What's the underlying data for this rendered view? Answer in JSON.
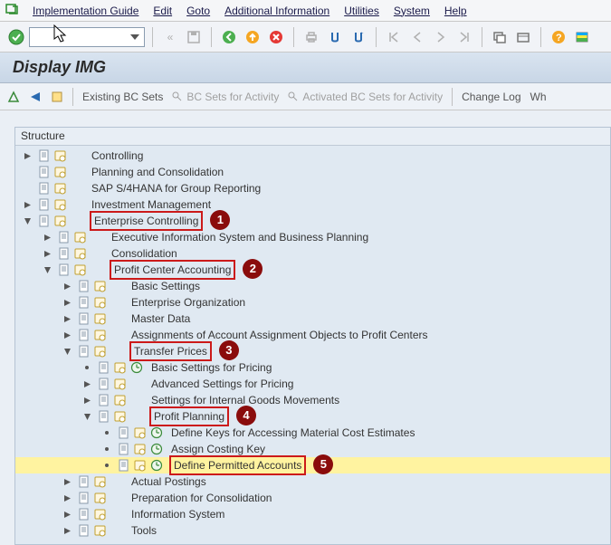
{
  "menu": {
    "items": [
      "Implementation Guide",
      "Edit",
      "Goto",
      "Additional Information",
      "Utilities",
      "System",
      "Help"
    ]
  },
  "title": "Display IMG",
  "subtoolbar": {
    "existing_bc_sets": "Existing BC Sets",
    "bc_sets_for_activity": "BC Sets for Activity",
    "activated_bc_sets": "Activated BC Sets for Activity",
    "change_log": "Change Log",
    "where_else": "Wh"
  },
  "tree": {
    "header": "Structure",
    "nodes": [
      {
        "depth": 0,
        "exp": "closed",
        "icons": [
          "doc",
          "exec"
        ],
        "label": "Controlling"
      },
      {
        "depth": 0,
        "exp": "none",
        "icons": [
          "doc",
          "exec"
        ],
        "label": "Planning and Consolidation"
      },
      {
        "depth": 0,
        "exp": "none",
        "icons": [
          "doc",
          "exec"
        ],
        "label": "SAP S/4HANA for Group Reporting"
      },
      {
        "depth": 0,
        "exp": "closed",
        "icons": [
          "doc",
          "exec"
        ],
        "label": "Investment Management"
      },
      {
        "depth": 0,
        "exp": "open",
        "icons": [
          "doc",
          "exec"
        ],
        "label": "Enterprise Controlling",
        "boxed": true,
        "badge": "1"
      },
      {
        "depth": 1,
        "exp": "closed",
        "icons": [
          "doc",
          "exec"
        ],
        "label": "Executive Information System and Business Planning"
      },
      {
        "depth": 1,
        "exp": "closed",
        "icons": [
          "doc",
          "exec"
        ],
        "label": "Consolidation"
      },
      {
        "depth": 1,
        "exp": "open",
        "icons": [
          "doc",
          "exec"
        ],
        "label": "Profit Center Accounting",
        "boxed": true,
        "badge": "2"
      },
      {
        "depth": 2,
        "exp": "closed",
        "icons": [
          "doc",
          "exec"
        ],
        "label": "Basic Settings"
      },
      {
        "depth": 2,
        "exp": "closed",
        "icons": [
          "doc",
          "exec"
        ],
        "label": "Enterprise Organization"
      },
      {
        "depth": 2,
        "exp": "closed",
        "icons": [
          "doc",
          "exec"
        ],
        "label": "Master Data"
      },
      {
        "depth": 2,
        "exp": "closed",
        "icons": [
          "doc",
          "exec"
        ],
        "label": "Assignments of Account Assignment Objects to Profit Centers"
      },
      {
        "depth": 2,
        "exp": "open",
        "icons": [
          "doc",
          "exec"
        ],
        "label": "Transfer Prices",
        "boxed": true,
        "badge": "3"
      },
      {
        "depth": 3,
        "exp": "leaf",
        "icons": [
          "doc",
          "exec",
          "clock"
        ],
        "label": "Basic Settings for Pricing"
      },
      {
        "depth": 3,
        "exp": "closed",
        "icons": [
          "doc",
          "exec"
        ],
        "label": "Advanced Settings for Pricing"
      },
      {
        "depth": 3,
        "exp": "closed",
        "icons": [
          "doc",
          "exec"
        ],
        "label": "Settings for Internal Goods Movements"
      },
      {
        "depth": 3,
        "exp": "open",
        "icons": [
          "doc",
          "exec"
        ],
        "label": "Profit Planning",
        "boxed": true,
        "badge": "4"
      },
      {
        "depth": 4,
        "exp": "leaf",
        "icons": [
          "doc",
          "exec",
          "clock"
        ],
        "label": "Define Keys for Accessing Material Cost Estimates"
      },
      {
        "depth": 4,
        "exp": "leaf",
        "icons": [
          "doc",
          "exec",
          "clock"
        ],
        "label": "Assign Costing Key"
      },
      {
        "depth": 4,
        "exp": "leaf",
        "icons": [
          "doc",
          "exec",
          "clock"
        ],
        "label": "Define Permitted Accounts",
        "boxed": true,
        "badge": "5",
        "hl": true
      },
      {
        "depth": 2,
        "exp": "closed",
        "icons": [
          "doc",
          "exec"
        ],
        "label": "Actual Postings"
      },
      {
        "depth": 2,
        "exp": "closed",
        "icons": [
          "doc",
          "exec"
        ],
        "label": "Preparation for Consolidation"
      },
      {
        "depth": 2,
        "exp": "closed",
        "icons": [
          "doc",
          "exec"
        ],
        "label": "Information System"
      },
      {
        "depth": 2,
        "exp": "closed",
        "icons": [
          "doc",
          "exec"
        ],
        "label": "Tools"
      }
    ]
  }
}
